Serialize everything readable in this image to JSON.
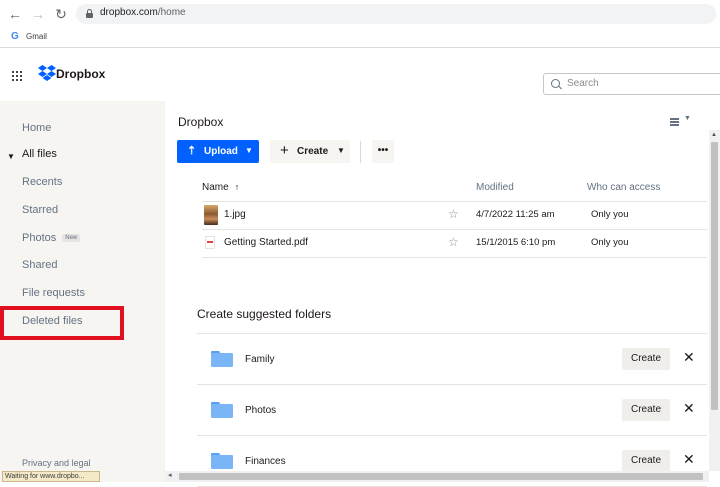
{
  "browser": {
    "url_host": "dropbox.com",
    "url_path": "/home",
    "bookmark_icon": "G",
    "bookmark_label": "Gmail",
    "status_text": "Waiting for www.dropbo..."
  },
  "header": {
    "brand": "Dropbox",
    "search_placeholder": "Search"
  },
  "sidebar": {
    "items": [
      {
        "label": "Home"
      },
      {
        "label": "All files"
      },
      {
        "label": "Recents"
      },
      {
        "label": "Starred"
      },
      {
        "label": "Photos",
        "badge": "New"
      },
      {
        "label": "Shared"
      },
      {
        "label": "File requests"
      },
      {
        "label": "Deleted files"
      }
    ],
    "footer": "Privacy and legal"
  },
  "main": {
    "breadcrumb": "Dropbox",
    "upload_label": "Upload",
    "create_label": "Create",
    "more_label": "•••",
    "columns": {
      "name": "Name",
      "sort_icon": "↑",
      "modified": "Modified",
      "access": "Who can access"
    },
    "files": [
      {
        "name": "1.jpg",
        "modified": "4/7/2022 11:25 am",
        "access": "Only you",
        "icon": "image-thumbnail"
      },
      {
        "name": "Getting Started.pdf",
        "modified": "15/1/2015 6:10 pm",
        "access": "Only you",
        "icon": "pdf-icon"
      }
    ],
    "suggest_title": "Create suggested folders",
    "suggested": [
      {
        "name": "Family",
        "button": "Create",
        "dismiss": "✕"
      },
      {
        "name": "Photos",
        "button": "Create",
        "dismiss": "✕"
      },
      {
        "name": "Finances",
        "button": "Create",
        "dismiss": "✕"
      }
    ]
  },
  "colors": {
    "accent": "#0061fe",
    "highlight": "#e01020",
    "sidebar_bg": "#f7f5f2"
  }
}
